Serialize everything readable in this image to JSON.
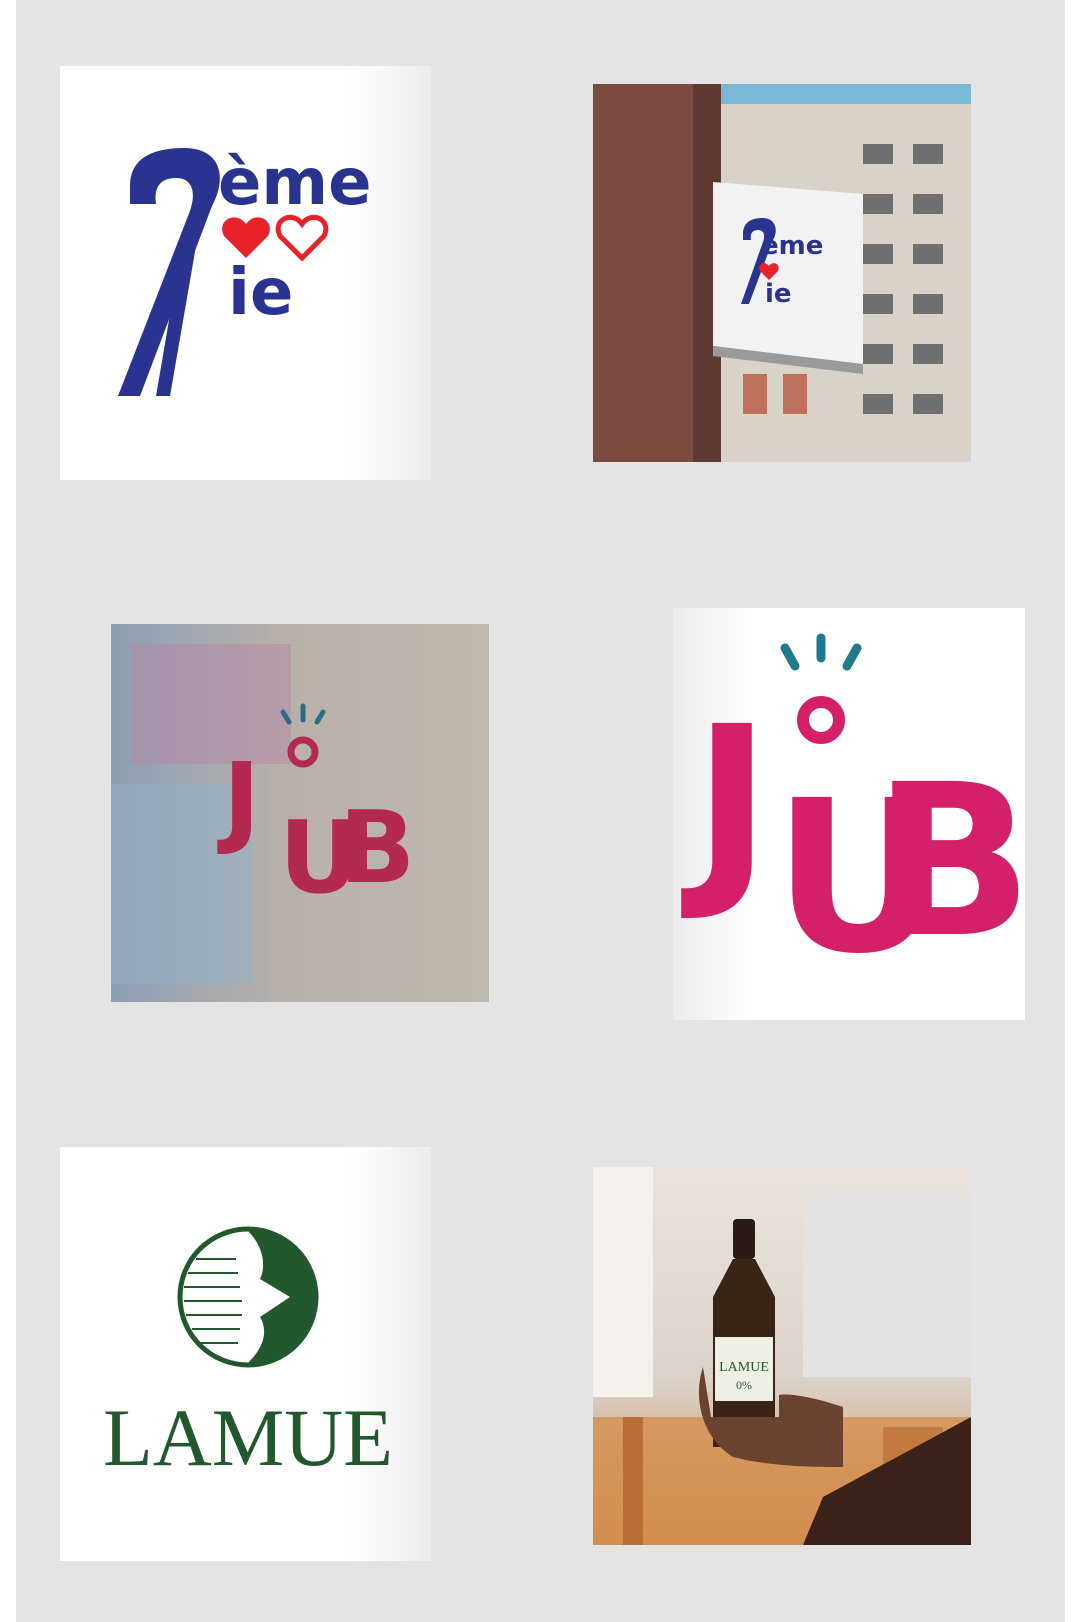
{
  "logos": {
    "deme_vie": {
      "top_word": "ème",
      "bottom_word": "ie",
      "colors": {
        "primary": "#2b3391",
        "heart": "#e8212b"
      }
    },
    "joub": {
      "letters": [
        "J",
        "O",
        "U",
        "B"
      ],
      "colors": {
        "primary": "#d41f6b",
        "rays": "#1f7a8c"
      }
    },
    "lamue": {
      "wordmark": "LAMUE",
      "colors": {
        "primary": "#22582e"
      }
    }
  },
  "mockups": {
    "sign": {
      "top_word": "ème",
      "bottom_word": "ie"
    },
    "shirt": {
      "letters": [
        "J",
        "O",
        "U",
        "B"
      ]
    },
    "bottle": {
      "label_word": "LAMUE",
      "label_abv": "0%"
    }
  },
  "palette": {
    "background": "#e4e4e4",
    "tile_white": "#ffffff"
  }
}
